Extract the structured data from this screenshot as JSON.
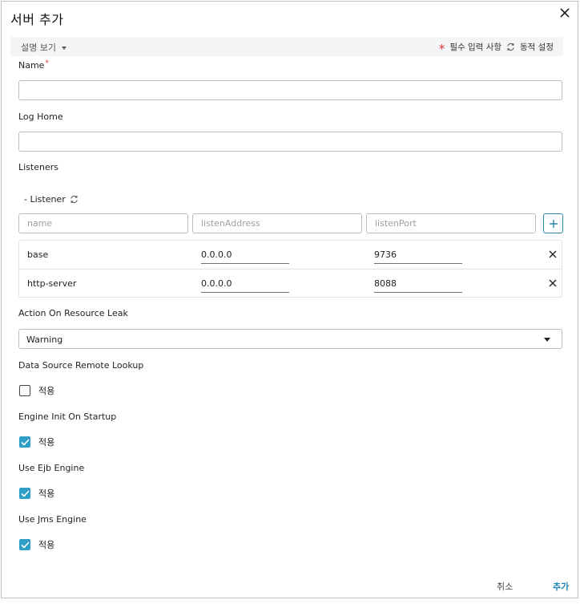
{
  "dialog": {
    "title": "서버 추가"
  },
  "infobar": {
    "desc_toggle": "설명 보기",
    "required_legend": "필수 입력 사항",
    "dynamic_legend": "동적 설정"
  },
  "form": {
    "name": {
      "label": "Name",
      "required_mark": "*",
      "value": ""
    },
    "log_home": {
      "label": "Log Home",
      "value": ""
    },
    "listeners": {
      "label": "Listeners",
      "sublabel": "- Listener",
      "placeholders": {
        "name": "name",
        "address": "listenAddress",
        "port": "listenPort"
      },
      "rows": [
        {
          "name": "base",
          "address": "0.0.0.0",
          "port": "9736"
        },
        {
          "name": "http-server",
          "address": "0.0.0.0",
          "port": "8088"
        }
      ]
    },
    "action_on_resource_leak": {
      "label": "Action On Resource Leak",
      "selected": "Warning"
    },
    "data_source_remote_lookup": {
      "label": "Data Source Remote Lookup",
      "check_label": "적용",
      "checked": false
    },
    "engine_init_on_startup": {
      "label": "Engine Init On Startup",
      "check_label": "적용",
      "checked": true
    },
    "use_ejb_engine": {
      "label": "Use Ejb Engine",
      "check_label": "적용",
      "checked": true
    },
    "use_jms_engine": {
      "label": "Use Jms Engine",
      "check_label": "적용",
      "checked": true
    }
  },
  "footer": {
    "cancel_label": "취소",
    "confirm_label": "추가"
  },
  "colors": {
    "accent": "#2f9ec8",
    "required": "#d9363e",
    "confirm_text": "#1f86b3"
  },
  "icons": [
    "close-icon",
    "chevron-down-icon",
    "required-star-icon",
    "sync-icon",
    "plus-icon",
    "delete-icon",
    "check-icon"
  ]
}
